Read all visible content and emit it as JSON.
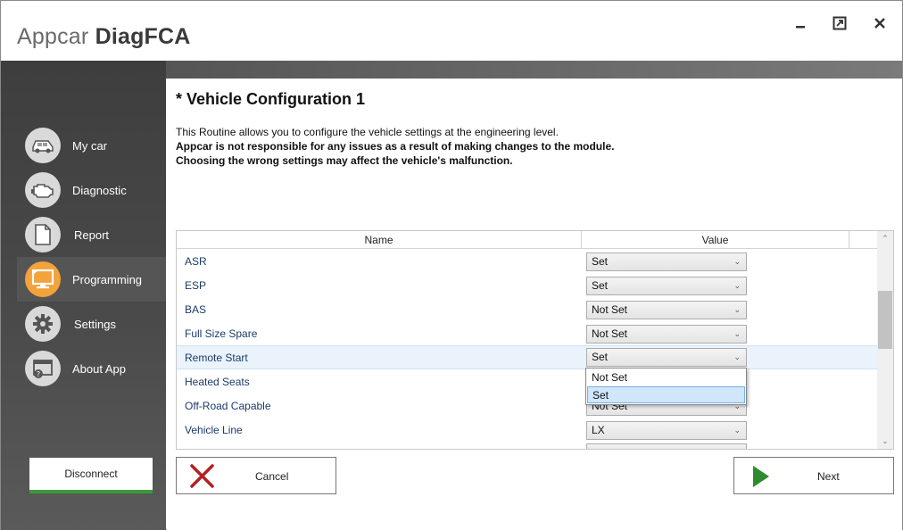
{
  "app": {
    "title_light": "Appcar",
    "title_bold": "DiagFCA"
  },
  "window_controls": {
    "minimize": "minimize-icon",
    "restore": "restore-icon",
    "close": "close-icon"
  },
  "sidebar": {
    "items": [
      {
        "label": "My car",
        "icon": "car-icon",
        "active": false
      },
      {
        "label": "Diagnostic",
        "icon": "engine-icon",
        "active": false
      },
      {
        "label": "Report",
        "icon": "document-icon",
        "active": false
      },
      {
        "label": "Programming",
        "icon": "monitor-icon",
        "active": true
      },
      {
        "label": "Settings",
        "icon": "gear-icon",
        "active": false
      },
      {
        "label": "About App",
        "icon": "info-icon",
        "active": false
      }
    ],
    "disconnect_label": "Disconnect"
  },
  "page": {
    "title": "* Vehicle Configuration 1",
    "desc_line1": "This Routine allows you to configure the vehicle settings at the engineering level.",
    "desc_line2": "Appcar is not responsible for any issues as a result of making changes to the module.",
    "desc_line3": "Choosing the wrong settings may affect the vehicle's malfunction."
  },
  "table": {
    "headers": {
      "name": "Name",
      "value": "Value"
    },
    "rows": [
      {
        "name": "ASR",
        "value": "Set"
      },
      {
        "name": "ESP",
        "value": "Set"
      },
      {
        "name": "BAS",
        "value": "Not Set"
      },
      {
        "name": "Full Size Spare",
        "value": "Not Set"
      },
      {
        "name": "Remote Start",
        "value": "Set"
      },
      {
        "name": "Heated Seats",
        "value": ""
      },
      {
        "name": "Off-Road Capable",
        "value": "Not Set"
      },
      {
        "name": "Vehicle Line",
        "value": "LX"
      }
    ]
  },
  "dropdown": {
    "options": [
      "Not Set",
      "Set"
    ],
    "selected": "Set"
  },
  "buttons": {
    "cancel": "Cancel",
    "next": "Next"
  },
  "colors": {
    "accent_active": "#f2a33a",
    "next_arrow": "#2e8b2e",
    "cancel_x": "#b52020",
    "disconnect_bar": "#3a9a3a"
  }
}
